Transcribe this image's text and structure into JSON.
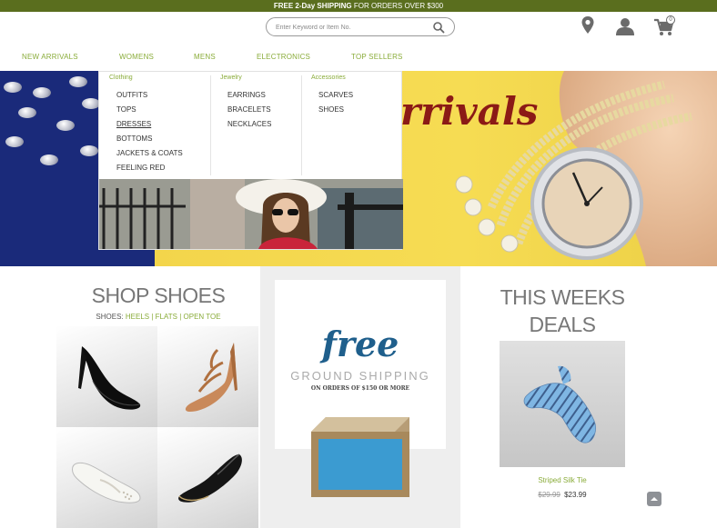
{
  "promo_bar": {
    "bold_text": "FREE 2-Day SHIPPING",
    "text": " FOR ORDERS OVER $300"
  },
  "search": {
    "placeholder": "Enter Keyword or Item No."
  },
  "header_icons": {
    "location": "location-icon",
    "account": "user-icon",
    "cart": "cart-icon",
    "cart_count": "0"
  },
  "nav": {
    "items": [
      "NEW ARRIVALS",
      "WOMENS",
      "MENS",
      "ELECTRONICS",
      "TOP SELLERS"
    ]
  },
  "mega_menu": {
    "columns": [
      {
        "heading": "Clothing",
        "links": [
          "OUTFITS",
          "TOPS",
          "DRESSES",
          "BOTTOMS",
          "JACKETS & COATS",
          "FEELING RED"
        ]
      },
      {
        "heading": "Jewelry",
        "links": [
          "EARRINGS",
          "BRACELETS",
          "NECKLACES"
        ]
      },
      {
        "heading": "Accessories",
        "links": [
          "SCARVES",
          "SHOES"
        ]
      }
    ],
    "active_link": "DRESSES"
  },
  "hero": {
    "title": "rrivals"
  },
  "shop_shoes": {
    "title": "SHOP SHOES",
    "filter_label": "SHOES:",
    "filters": [
      "HEELS",
      "FLATS",
      "OPEN TOE"
    ]
  },
  "shipping_promo": {
    "headline": "free",
    "subline": "GROUND SHIPPING",
    "note": "ON ORDERS OF $150 OR MORE"
  },
  "deals": {
    "title_line1": "THIS WEEKS",
    "title_line2": "DEALS",
    "product_name": "Striped Silk Tie",
    "old_price": "$29.99",
    "price": "$23.99"
  },
  "colors": {
    "accent_green": "#8aac3a",
    "topbar_green": "#5a6e1e",
    "hero_title": "#8b1a16",
    "free_blue": "#1f5f8c"
  }
}
